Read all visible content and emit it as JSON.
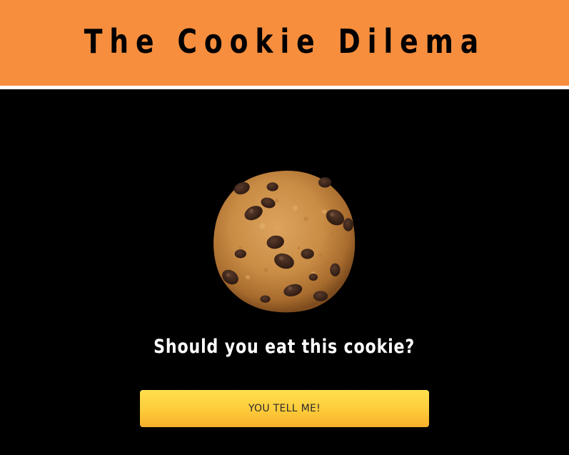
{
  "header": {
    "title": "The Cookie Dilema",
    "background_color": "#F68E3E"
  },
  "main": {
    "image": {
      "icon": "chocolate-chip-cookie-icon"
    },
    "question": "Should you eat this cookie?",
    "button": {
      "label": "YOU TELL ME!",
      "gradient_top": "#FFE04F",
      "gradient_bottom": "#F7AF2C"
    }
  },
  "colors": {
    "page_background": "#000000",
    "divider": "#FFFFFF",
    "text_light": "#FFFFFF",
    "text_dark": "#000000"
  }
}
